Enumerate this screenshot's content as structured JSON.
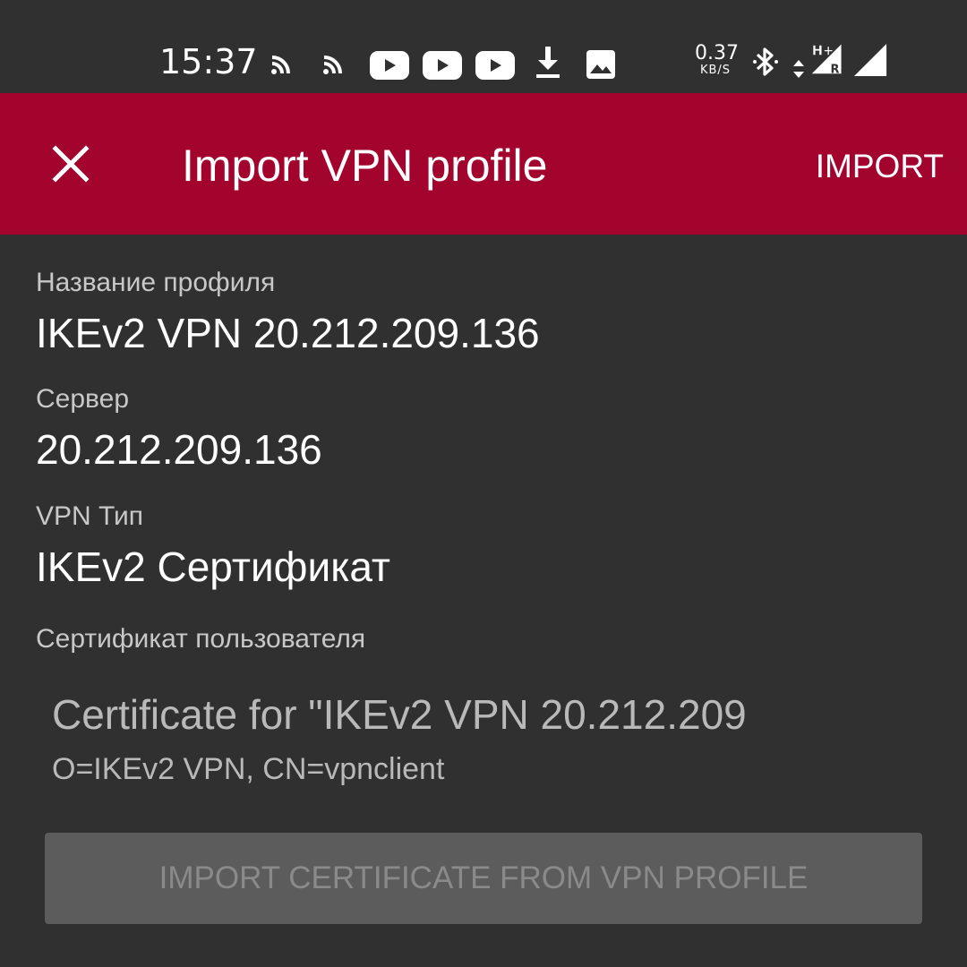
{
  "status_bar": {
    "time": "15:37",
    "net_speed_value": "0.37",
    "net_speed_unit": "KB/S",
    "network_type": "H+",
    "roaming": "R",
    "notification_icons": [
      "cast-icon",
      "cast-icon",
      "youtube-icon",
      "youtube-icon",
      "youtube-icon",
      "download-icon",
      "image-icon"
    ],
    "system_icons": [
      "bluetooth-icon",
      "data-activity-icon",
      "signal-icon"
    ]
  },
  "app_bar": {
    "title": "Import VPN profile",
    "action_label": "IMPORT",
    "background_color": "#a3042d"
  },
  "form": {
    "profile_name_label": "Название профиля",
    "profile_name_value": "IKEv2 VPN 20.212.209.136",
    "server_label": "Сервер",
    "server_value": "20.212.209.136",
    "vpn_type_label": "VPN Тип",
    "vpn_type_value": "IKEv2 Сертификат",
    "user_cert_label": "Сертификат пользователя",
    "cert_title": "Certificate for \"IKEv2 VPN 20.212.209",
    "cert_subject": "O=IKEv2 VPN, CN=vpnclient"
  },
  "buttons": {
    "import_cert_label": "IMPORT CERTIFICATE FROM VPN PROFILE"
  }
}
